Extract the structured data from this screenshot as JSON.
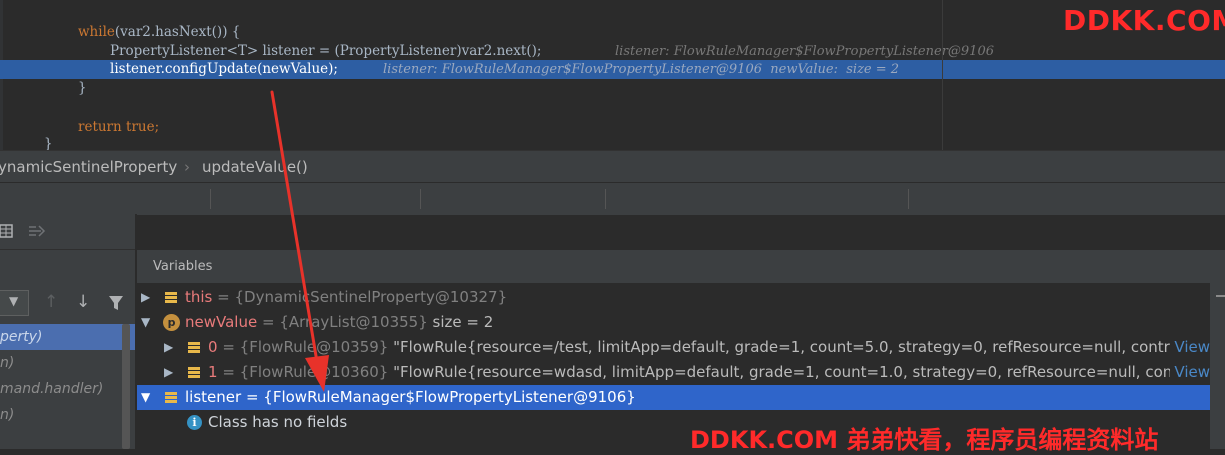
{
  "editor": {
    "lines": [
      {
        "kw": "while",
        "code": "(var2.hasNext()) {",
        "hint": ""
      },
      {
        "code": "PropertyListener<T> listener = (PropertyListener)var2.next();",
        "hint": "listener: FlowRuleManager$FlowPropertyListener@9106"
      },
      {
        "code": "listener.configUpdate(newValue);",
        "hint": "listener: FlowRuleManager$FlowPropertyListener@9106  newValue:  size = 2"
      },
      {
        "code": "}"
      },
      {
        "kw": "return",
        "code2": "true",
        "semi": ";"
      },
      {
        "code": "}"
      }
    ]
  },
  "breadcrumb": {
    "class_name": "ynamicSentinelProperty",
    "separator": "›",
    "method": "updateValue()"
  },
  "variables": {
    "header": "Variables",
    "rows": [
      {
        "name": "this",
        "eq": " = ",
        "type": "{DynamicSentinelProperty@10327}"
      },
      {
        "name": "newValue",
        "eq": " = ",
        "type": "{ArrayList@10355}",
        "extra": "size = 2",
        "badge": "p"
      },
      {
        "name": "0",
        "eq": " = ",
        "type": "{FlowRule@10359}",
        "value": "\"FlowRule{resource=/test, limitApp=default, grade=1, count=5.0, strategy=0, refResource=null, controlBeh...",
        "link": "View"
      },
      {
        "name": "1",
        "eq": " = ",
        "type": "{FlowRule@10360}",
        "value": "\"FlowRule{resource=wdasd, limitApp=default, grade=1, count=1.0, strategy=0, refResource=null, controlBe...",
        "link": "View"
      },
      {
        "name": "listener",
        "eq": " = ",
        "type": "{FlowRuleManager$FlowPropertyListener@9106}"
      },
      {
        "text": "Class has no fields"
      }
    ]
  },
  "frames": {
    "items": [
      "perty)",
      "n)",
      "mand.handler)",
      "n)"
    ]
  },
  "watermarks": {
    "top": "DDKK.COM",
    "bottom": "DDKK.COM 弟弟快看，程序员编程资料站"
  },
  "colors": {
    "arrow": "#e8322a",
    "highlight_line": "#2d5ea3",
    "selected_row": "#2f65ca"
  }
}
